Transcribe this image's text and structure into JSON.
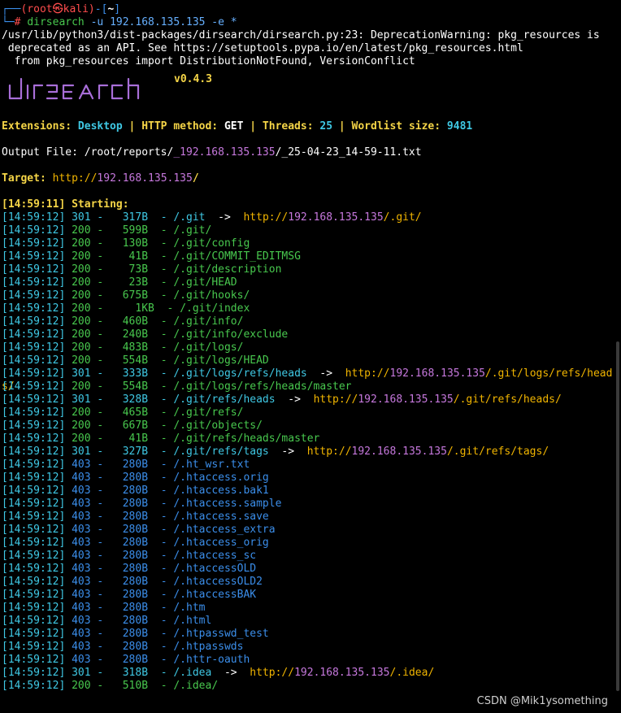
{
  "prompt": {
    "top_corner": "┌──",
    "user": "(root㉿kali)",
    "bracket_open": "-[",
    "cwd": "~",
    "bracket_close": "]",
    "bottom_corner": "└─",
    "hash": "# ",
    "cmd": "dirsearch",
    "args": " -u 192.168.135.135 -e *"
  },
  "warning": {
    "line1": "/usr/lib/python3/dist-packages/dirsearch/dirsearch.py:23: DeprecationWarning: pkg_resources is",
    "line2": " deprecated as an API. See https://setuptools.pypa.io/en/latest/pkg_resources.html",
    "line3": "  from pkg_resources import DistributionNotFound, VersionConflict"
  },
  "logo": {
    "text": "dirsearch",
    "version": "v0.4.3"
  },
  "config": {
    "ext_label": "Extensions: ",
    "ext_value": "Desktop",
    "sep": " | ",
    "method_label": "HTTP method: ",
    "method_value": "GET",
    "threads_label": "Threads: ",
    "threads_value": "25",
    "wordlist_label": "Wordlist size: ",
    "wordlist_value": "9481"
  },
  "output": {
    "label": "Output File: ",
    "path_a": "/root/reports/",
    "path_b": "_192.168.135.135",
    "path_c": "/",
    "path_d": "_25-04-23_14-59-11.txt"
  },
  "target": {
    "label": "Target: ",
    "scheme": "http://",
    "host": "192.168.135.135",
    "slash": "/"
  },
  "starting": {
    "time": "[14:59:11]",
    "text": " Starting:"
  },
  "results": [
    {
      "t": "[14:59:12]",
      "code": "301",
      "size": " 317B",
      "path": "/.git",
      "redirect": {
        "scheme": "http://",
        "host": "192.168.135.135",
        "rest": "/.git/"
      }
    },
    {
      "t": "[14:59:12]",
      "code": "200",
      "size": " 599B",
      "path": "/.git/"
    },
    {
      "t": "[14:59:12]",
      "code": "200",
      "size": " 130B",
      "path": "/.git/config"
    },
    {
      "t": "[14:59:12]",
      "code": "200",
      "size": "  41B",
      "path": "/.git/COMMIT_EDITMSG"
    },
    {
      "t": "[14:59:12]",
      "code": "200",
      "size": "  73B",
      "path": "/.git/description"
    },
    {
      "t": "[14:59:12]",
      "code": "200",
      "size": "  23B",
      "path": "/.git/HEAD"
    },
    {
      "t": "[14:59:12]",
      "code": "200",
      "size": " 675B",
      "path": "/.git/hooks/"
    },
    {
      "t": "[14:59:12]",
      "code": "200",
      "size": "   1KB",
      "path": "/.git/index"
    },
    {
      "t": "[14:59:12]",
      "code": "200",
      "size": " 460B",
      "path": "/.git/info/"
    },
    {
      "t": "[14:59:12]",
      "code": "200",
      "size": " 240B",
      "path": "/.git/info/exclude"
    },
    {
      "t": "[14:59:12]",
      "code": "200",
      "size": " 483B",
      "path": "/.git/logs/"
    },
    {
      "t": "[14:59:12]",
      "code": "200",
      "size": " 554B",
      "path": "/.git/logs/HEAD"
    },
    {
      "t": "[14:59:12]",
      "code": "301",
      "size": " 333B",
      "path": "/.git/logs/refs/heads",
      "redirect": {
        "scheme": "http://",
        "host": "192.168.135.135",
        "rest": "/.git/logs/refs/heads/"
      }
    },
    {
      "t": "[14:59:12]",
      "code": "200",
      "size": " 554B",
      "path": "/.git/logs/refs/heads/master"
    },
    {
      "t": "[14:59:12]",
      "code": "301",
      "size": " 328B",
      "path": "/.git/refs/heads",
      "redirect": {
        "scheme": "http://",
        "host": "192.168.135.135",
        "rest": "/.git/refs/heads/"
      }
    },
    {
      "t": "[14:59:12]",
      "code": "200",
      "size": " 465B",
      "path": "/.git/refs/"
    },
    {
      "t": "[14:59:12]",
      "code": "200",
      "size": " 667B",
      "path": "/.git/objects/"
    },
    {
      "t": "[14:59:12]",
      "code": "200",
      "size": "  41B",
      "path": "/.git/refs/heads/master"
    },
    {
      "t": "[14:59:12]",
      "code": "301",
      "size": " 327B",
      "path": "/.git/refs/tags",
      "redirect": {
        "scheme": "http://",
        "host": "192.168.135.135",
        "rest": "/.git/refs/tags/"
      }
    },
    {
      "t": "[14:59:12]",
      "code": "403",
      "size": " 280B",
      "path": "/.ht_wsr.txt"
    },
    {
      "t": "[14:59:12]",
      "code": "403",
      "size": " 280B",
      "path": "/.htaccess.orig"
    },
    {
      "t": "[14:59:12]",
      "code": "403",
      "size": " 280B",
      "path": "/.htaccess.bak1"
    },
    {
      "t": "[14:59:12]",
      "code": "403",
      "size": " 280B",
      "path": "/.htaccess.sample"
    },
    {
      "t": "[14:59:12]",
      "code": "403",
      "size": " 280B",
      "path": "/.htaccess.save"
    },
    {
      "t": "[14:59:12]",
      "code": "403",
      "size": " 280B",
      "path": "/.htaccess_extra"
    },
    {
      "t": "[14:59:12]",
      "code": "403",
      "size": " 280B",
      "path": "/.htaccess_orig"
    },
    {
      "t": "[14:59:12]",
      "code": "403",
      "size": " 280B",
      "path": "/.htaccess_sc"
    },
    {
      "t": "[14:59:12]",
      "code": "403",
      "size": " 280B",
      "path": "/.htaccessOLD"
    },
    {
      "t": "[14:59:12]",
      "code": "403",
      "size": " 280B",
      "path": "/.htaccessOLD2"
    },
    {
      "t": "[14:59:12]",
      "code": "403",
      "size": " 280B",
      "path": "/.htaccessBAK"
    },
    {
      "t": "[14:59:12]",
      "code": "403",
      "size": " 280B",
      "path": "/.htm"
    },
    {
      "t": "[14:59:12]",
      "code": "403",
      "size": " 280B",
      "path": "/.html"
    },
    {
      "t": "[14:59:12]",
      "code": "403",
      "size": " 280B",
      "path": "/.htpasswd_test"
    },
    {
      "t": "[14:59:12]",
      "code": "403",
      "size": " 280B",
      "path": "/.htpasswds"
    },
    {
      "t": "[14:59:12]",
      "code": "403",
      "size": " 280B",
      "path": "/.httr-oauth"
    },
    {
      "t": "[14:59:12]",
      "code": "301",
      "size": " 318B",
      "path": "/.idea",
      "redirect": {
        "scheme": "http://",
        "host": "192.168.135.135",
        "rest": "/.idea/"
      }
    },
    {
      "t": "[14:59:12]",
      "code": "200",
      "size": " 510B",
      "path": "/.idea/"
    }
  ],
  "labels": {
    "dash": " -  ",
    "dash2": "  - ",
    "arrow": "  ->  "
  },
  "watermark": "CSDN @Mik1ysomething",
  "colors": {
    "c200": "#48c84e",
    "c301": "#3fc8e4",
    "c403": "#3b8eea",
    "time": "#3fc8e4"
  }
}
